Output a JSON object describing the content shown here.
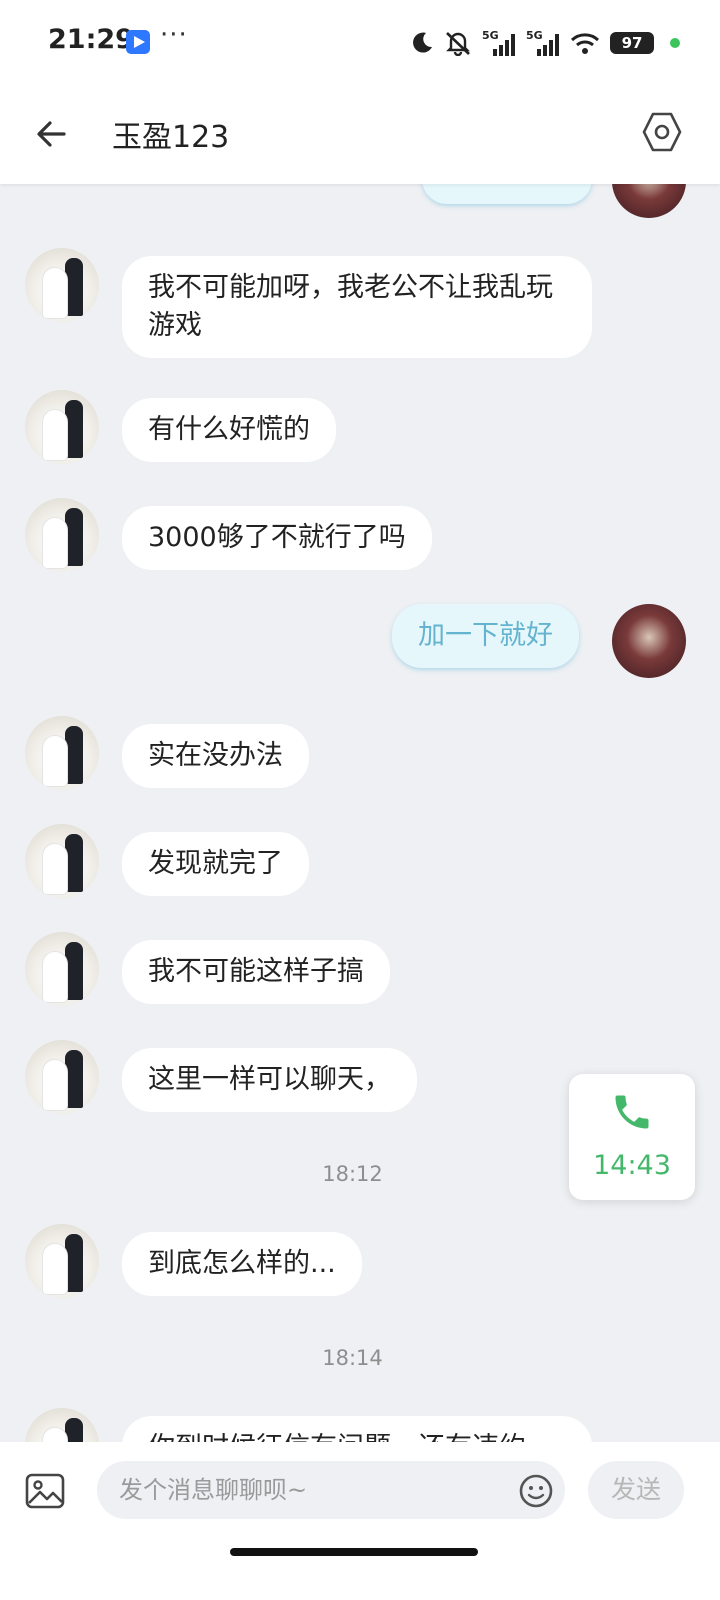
{
  "status_bar": {
    "time": "21:29",
    "more_dots": "···",
    "signal1_label": "5G",
    "signal2_label": "5G",
    "battery_level": "97",
    "icons": [
      "play-app-icon",
      "moon-icon",
      "mute-icon",
      "signal-5g-icon",
      "signal-5g-icon",
      "wifi-icon",
      "battery-icon"
    ]
  },
  "header": {
    "title": "玉盈123",
    "back_icon": "arrow-left-icon",
    "settings_icon": "hexagon-settings-icon"
  },
  "messages": [
    {
      "side": "left",
      "text": "我不可能加呀，我老公不让我乱玩游戏"
    },
    {
      "side": "left",
      "text": "有什么好慌的"
    },
    {
      "side": "left",
      "text": "3000够了不就行了吗"
    },
    {
      "side": "right",
      "text": "加一下就好"
    },
    {
      "side": "left",
      "text": "实在没办法"
    },
    {
      "side": "left",
      "text": "发现就完了"
    },
    {
      "side": "left",
      "text": "我不可能这样子搞"
    },
    {
      "side": "left",
      "text": "这里一样可以聊天，"
    },
    {
      "type": "timestamp",
      "text": "18:12"
    },
    {
      "side": "left",
      "text": "到底怎么样的..."
    },
    {
      "type": "timestamp",
      "text": "18:14"
    },
    {
      "side": "left",
      "text": "你到时候征信有问题，还有违约"
    }
  ],
  "call_widget": {
    "icon": "phone-icon",
    "duration": "14:43",
    "color": "#44b86a"
  },
  "input_bar": {
    "placeholder": "发个消息聊聊呗~",
    "value": "",
    "send_label": "发送",
    "image_icon": "image-icon",
    "emoji_icon": "emoji-icon"
  },
  "colors": {
    "background": "#eef0f3",
    "my_bubble_bg": "#e6f7fc",
    "my_bubble_text": "#64b4cf",
    "other_bubble_bg": "#ffffff"
  }
}
